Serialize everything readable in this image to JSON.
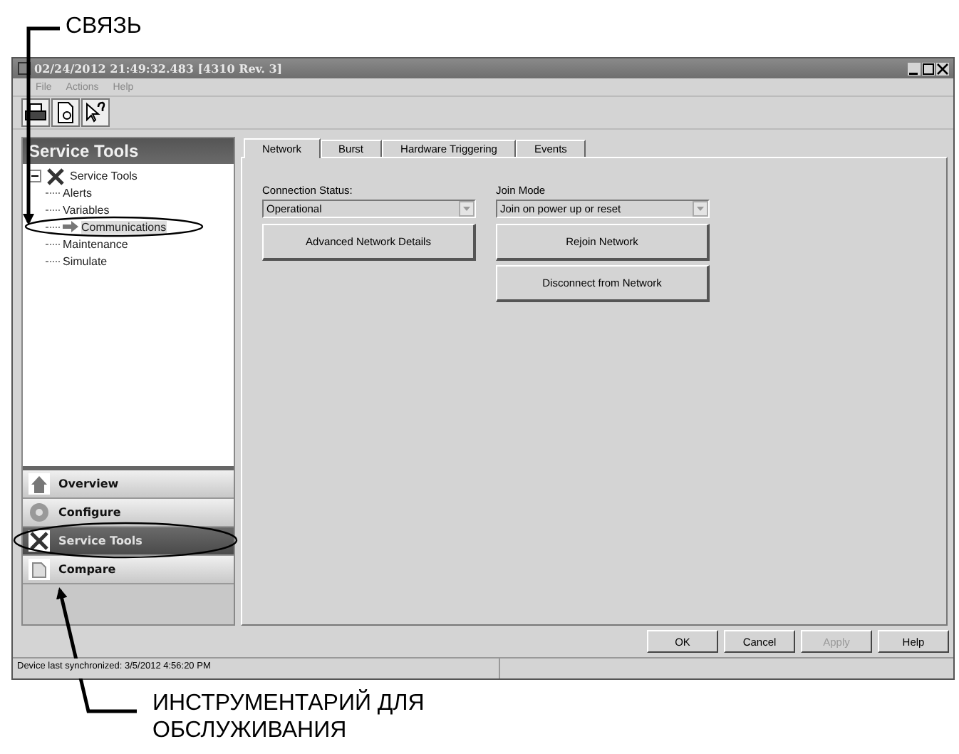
{
  "annotations": [
    {
      "text": "СВЯЗЬ"
    },
    {
      "text": "ИНСТРУМЕНТАРИЙ ДЛЯ ОБСЛУЖИВАНИЯ"
    }
  ],
  "window": {
    "title": "02/24/2012 21:49:32.483 [4310 Rev. 3]"
  },
  "menu": [
    "File",
    "Actions",
    "Help"
  ],
  "left_panel": {
    "title": "Service Tools",
    "tree": {
      "label": "Service Tools",
      "expanded": true,
      "children": [
        {
          "label": "Alerts",
          "selected": false
        },
        {
          "label": "Variables",
          "selected": false
        },
        {
          "label": "Communications",
          "selected": true
        },
        {
          "label": "Maintenance",
          "selected": false
        },
        {
          "label": "Simulate",
          "selected": false
        }
      ]
    },
    "nav": [
      {
        "label": "Overview",
        "selected": false
      },
      {
        "label": "Configure",
        "selected": false
      },
      {
        "label": "Service Tools",
        "selected": true
      },
      {
        "label": "Compare",
        "selected": false
      }
    ]
  },
  "tabs": [
    {
      "label": "Network",
      "selected": true
    },
    {
      "label": "Burst",
      "selected": false
    },
    {
      "label": "Hardware Triggering",
      "selected": false
    },
    {
      "label": "Events",
      "selected": false
    }
  ],
  "columns": [
    {
      "field": {
        "label": "Connection Status:",
        "value": "Operational"
      },
      "buttons": [
        "Advanced Network Details"
      ]
    },
    {
      "field": {
        "label": "Join Mode",
        "value": "Join on power up or reset"
      },
      "buttons": [
        "Rejoin Network",
        "Disconnect from Network"
      ]
    }
  ],
  "dialog_buttons": [
    {
      "label": "OK",
      "disabled": false
    },
    {
      "label": "Cancel",
      "disabled": false
    },
    {
      "label": "Apply",
      "disabled": true
    },
    {
      "label": "Help",
      "disabled": false
    }
  ],
  "status_bar": "Device last synchronized: 3/5/2012 4:56:20 PM"
}
